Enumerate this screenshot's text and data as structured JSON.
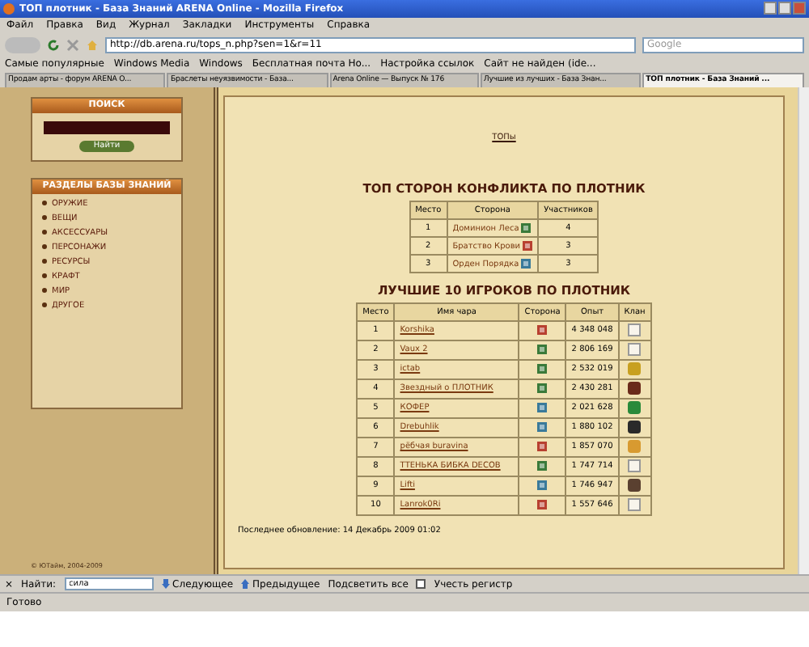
{
  "window": {
    "title": "ТОП плотник - База Знаний ARENA Online - Mozilla Firefox"
  },
  "menu": [
    "Файл",
    "Правка",
    "Вид",
    "Журнал",
    "Закладки",
    "Инструменты",
    "Справка"
  ],
  "address": {
    "value": "http://db.arena.ru/tops_n.php?sen=1&r=11"
  },
  "search": {
    "placeholder": "Google"
  },
  "bookmarks": [
    "Самые популярные",
    "Windows Media",
    "Windows",
    "Бесплатная почта Ho...",
    "Настройка ссылок",
    "Сайт не найден (ide..."
  ],
  "tabs": [
    {
      "label": "Продам арты - форум ARENA O...",
      "selected": false
    },
    {
      "label": "Браслеты неуязвимости - База...",
      "selected": false
    },
    {
      "label": "Arena Online — Выпуск № 176",
      "selected": false
    },
    {
      "label": "Лучшие из лучших - База Знан...",
      "selected": false
    },
    {
      "label": "ТОП плотник - База Знаний ...",
      "selected": true
    }
  ],
  "sidebar": {
    "search_title": "ПОИСК",
    "search_button": "Найти",
    "sections_title": "РАЗДЕЛЫ БАЗЫ ЗНАНИЙ",
    "items": [
      "ОРУЖИЕ",
      "ВЕЩИ",
      "АКСЕССУАРЫ",
      "ПЕРСОНАЖИ",
      "РЕСУРСЫ",
      "КРАФТ",
      "МИР",
      "ДРУГОЕ"
    ],
    "copyright": "© ЮТайм, 2004-2009"
  },
  "main": {
    "link": "ТОПы",
    "sides_title": "ТОП СТОРОН КОНФЛИКТА ПО ПЛОТНИК",
    "sides_columns": [
      "Место",
      "Сторона",
      "Участников"
    ],
    "sides": [
      {
        "place": "1",
        "name": "Доминион Леса",
        "color": "#3a7a3a",
        "count": "4"
      },
      {
        "place": "2",
        "name": "Братство Крови",
        "color": "#b84030",
        "count": "3"
      },
      {
        "place": "3",
        "name": "Орден Порядка",
        "color": "#3a7a9a",
        "count": "3"
      }
    ],
    "players_title": "ЛУЧШИЕ 10 ИГРОКОВ ПО ПЛОТНИК",
    "players_columns": [
      "Место",
      "Имя чара",
      "Сторона",
      "Опыт",
      "Клан"
    ],
    "players": [
      {
        "place": "1",
        "name": "Korshika",
        "side": {
          "color": "#b84030"
        },
        "exp": "4 348 048",
        "clan": {
          "kind": "blank"
        }
      },
      {
        "place": "2",
        "name": "Vaux 2",
        "side": {
          "color": "#3a7a3a"
        },
        "exp": "2 806 169",
        "clan": {
          "kind": "blank"
        }
      },
      {
        "place": "3",
        "name": "ictab",
        "side": {
          "color": "#3a7a3a"
        },
        "exp": "2 532 019",
        "clan": {
          "kind": "emblem",
          "color": "#c8a020"
        }
      },
      {
        "place": "4",
        "name": "Звездный о ПЛОТНИК",
        "side": {
          "color": "#3a7a3a"
        },
        "exp": "2 430 281",
        "clan": {
          "kind": "emblem",
          "color": "#6a2a1a"
        }
      },
      {
        "place": "5",
        "name": "КОФЕР",
        "side": {
          "color": "#3a7a9a"
        },
        "exp": "2 021 628",
        "clan": {
          "kind": "emblem",
          "color": "#2a8a3a"
        }
      },
      {
        "place": "6",
        "name": "Drebuhlik",
        "side": {
          "color": "#3a7a9a"
        },
        "exp": "1 880 102",
        "clan": {
          "kind": "emblem",
          "color": "#2a2a2a"
        }
      },
      {
        "place": "7",
        "name": "рёбчая buravina",
        "side": {
          "color": "#b84030"
        },
        "exp": "1 857 070",
        "clan": {
          "kind": "emblem",
          "color": "#d89a30"
        }
      },
      {
        "place": "8",
        "name": "ТТЕНЬКА БИБКА DECOB",
        "side": {
          "color": "#3a7a3a"
        },
        "exp": "1 747 714",
        "clan": {
          "kind": "blank"
        }
      },
      {
        "place": "9",
        "name": "Lifti",
        "side": {
          "color": "#3a7a9a"
        },
        "exp": "1 746 947",
        "clan": {
          "kind": "emblem",
          "color": "#5a4030"
        }
      },
      {
        "place": "10",
        "name": "Lanrok0Ri",
        "side": {
          "color": "#b84030"
        },
        "exp": "1 557 646",
        "clan": {
          "kind": "blank"
        }
      }
    ],
    "updated": "Последнее обновление: 14 Декабрь 2009 01:02"
  },
  "find_bar": {
    "close": "×",
    "label": "Найти:",
    "value": "сила",
    "next": "Следующее",
    "previous": "Предыдущее",
    "highlight": "Подсветить все",
    "match_case": {
      "label": "Учесть регистр",
      "checked": false
    }
  },
  "status_bar": {
    "text": "Готово"
  }
}
